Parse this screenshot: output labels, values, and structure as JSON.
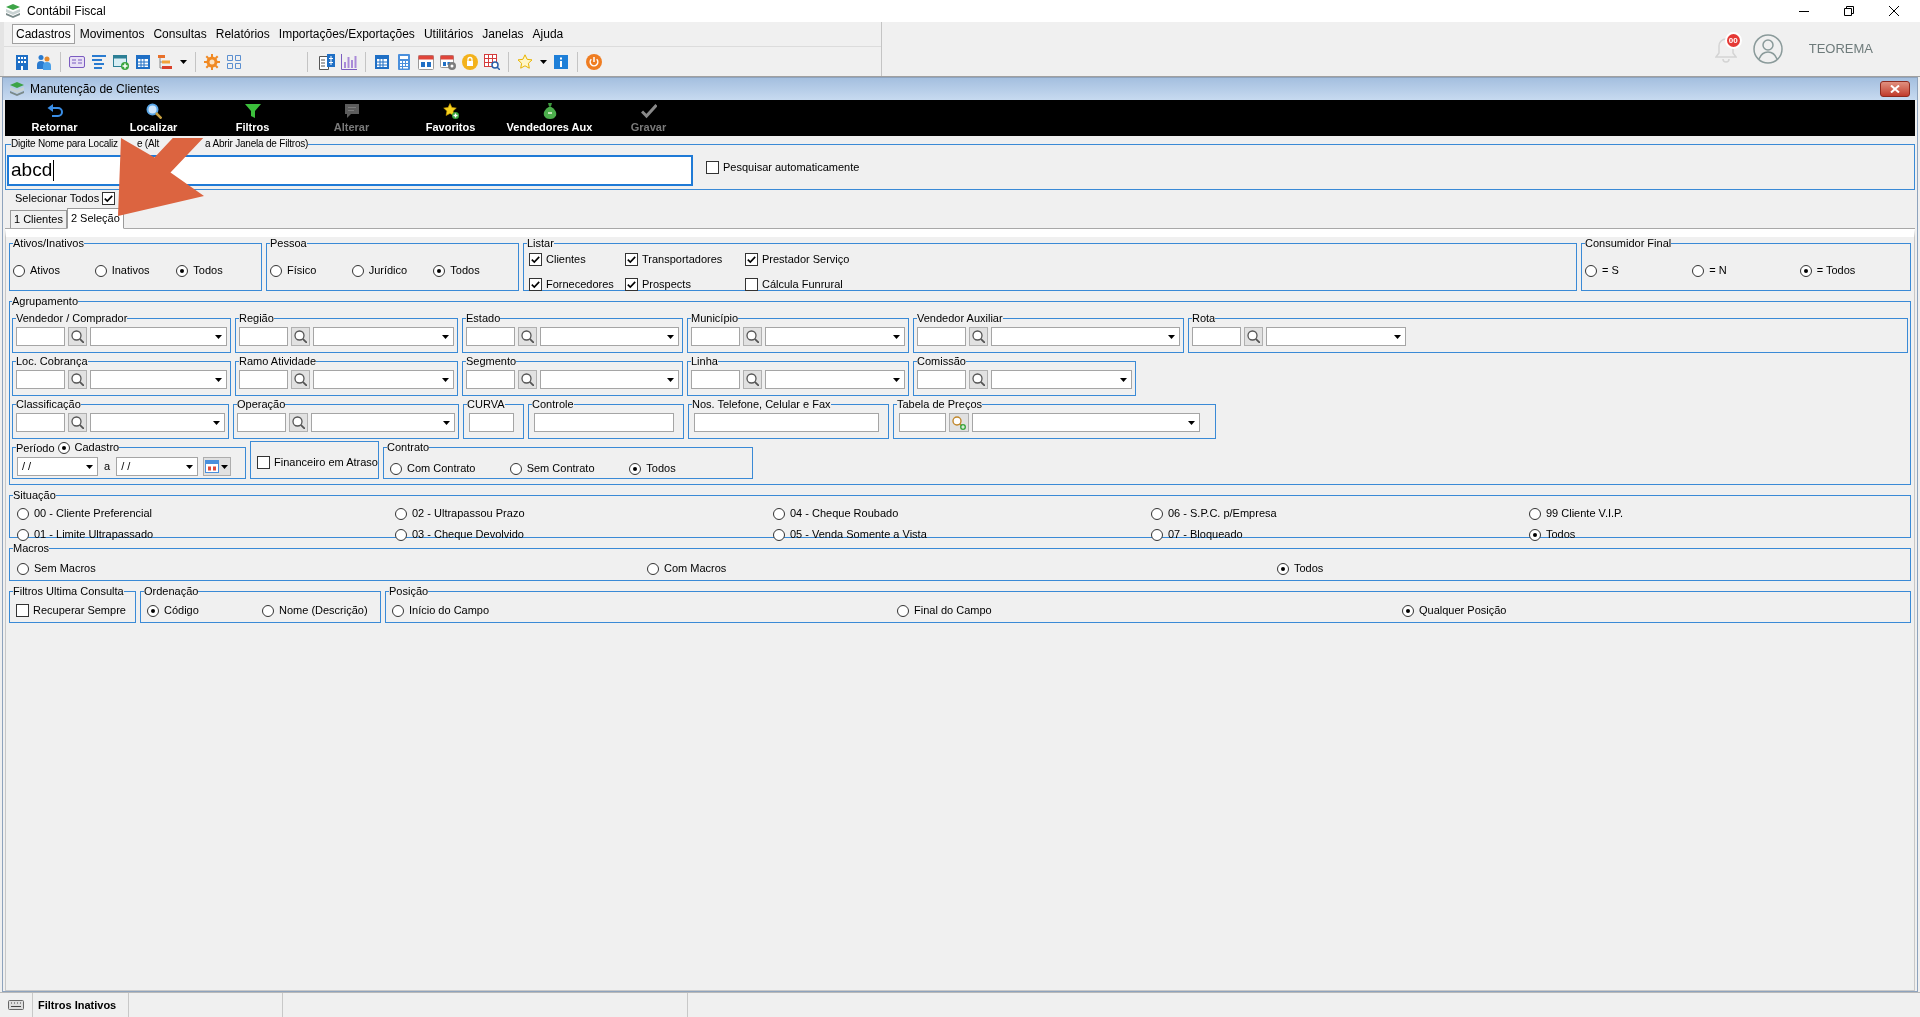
{
  "window": {
    "title": "Contábil Fiscal"
  },
  "menu": [
    {
      "label": "Cadastros",
      "selected": true
    },
    {
      "label": "Movimentos",
      "selected": false
    },
    {
      "label": "Consultas",
      "selected": false
    },
    {
      "label": "Relatórios",
      "selected": false
    },
    {
      "label": "Importações/Exportações",
      "selected": false
    },
    {
      "label": "Utilitários",
      "selected": false
    },
    {
      "label": "Janelas",
      "selected": false
    },
    {
      "label": "Ajuda",
      "selected": false
    }
  ],
  "header": {
    "notification_count": "00",
    "user": "TEOREMA"
  },
  "child_window": {
    "title": "Manutenção de Clientes"
  },
  "actions": [
    {
      "label": "Retornar",
      "disabled": false
    },
    {
      "label": "Localizar",
      "disabled": false
    },
    {
      "label": "Filtros",
      "disabled": false
    },
    {
      "label": "Alterar",
      "disabled": true
    },
    {
      "label": "Favoritos",
      "disabled": false
    },
    {
      "label": "Vendedores Aux",
      "disabled": false
    },
    {
      "label": "Gravar",
      "disabled": true
    }
  ],
  "search": {
    "label_parts": [
      "Digite Nome para Localiz",
      "e (Alt",
      "a Abrir Janela de Filtros)"
    ],
    "value": "abcd",
    "auto_search": {
      "label": "Pesquisar automaticamente",
      "checked": false
    }
  },
  "select_all": {
    "label": "Selecionar Todos",
    "checked": true
  },
  "tabs": [
    {
      "label": "1 Clientes",
      "selected": false
    },
    {
      "label": "2 Seleção",
      "selected": true
    }
  ],
  "top_groups": [
    {
      "kind": "radio",
      "title": "Ativos/Inativos",
      "options": [
        {
          "label": "Ativos",
          "selected": false
        },
        {
          "label": "Inativos",
          "selected": false
        },
        {
          "label": "Todos",
          "selected": true
        }
      ]
    },
    {
      "kind": "radio",
      "title": "Pessoa",
      "options": [
        {
          "label": "Físico",
          "selected": false
        },
        {
          "label": "Jurídico",
          "selected": false
        },
        {
          "label": "Todos",
          "selected": true
        }
      ]
    },
    {
      "kind": "checks",
      "title": "Listar",
      "options": [
        {
          "label": "Clientes",
          "checked": true
        },
        {
          "label": "Transportadores",
          "checked": true
        },
        {
          "label": "Prestador Serviço",
          "checked": true
        },
        {
          "label": "Fornecedores",
          "checked": true
        },
        {
          "label": "Prospects",
          "checked": true
        },
        {
          "label": "Cálcula Funrural",
          "checked": false
        }
      ]
    },
    {
      "kind": "radio",
      "title": "Consumidor Final",
      "options": [
        {
          "label": "= S",
          "selected": false
        },
        {
          "label": "= N",
          "selected": false
        },
        {
          "label": "= Todos",
          "selected": true
        }
      ]
    }
  ],
  "grouping": {
    "title": "Agrupamento",
    "lines": [
      {
        "groups": [
          {
            "kind": "lookup",
            "title": "Vendedor / Comprador"
          },
          {
            "kind": "lookup",
            "title": "Região"
          },
          {
            "kind": "lookup",
            "title": "Estado"
          },
          {
            "kind": "lookup",
            "title": "Município"
          },
          {
            "kind": "lookup",
            "title": "Vendedor Auxiliar"
          },
          {
            "kind": "lookup",
            "title": "Rota"
          }
        ]
      },
      {
        "groups": [
          {
            "kind": "lookup",
            "title": "Loc. Cobrança"
          },
          {
            "kind": "lookup",
            "title": "Ramo Atividade"
          },
          {
            "kind": "lookup",
            "title": "Segmento"
          },
          {
            "kind": "lookup",
            "title": "Linha"
          },
          {
            "kind": "lookup",
            "title": "Comissão"
          }
        ]
      },
      {
        "groups": [
          {
            "kind": "lookup",
            "title": "Classificação"
          },
          {
            "kind": "lookup",
            "title": "Operação"
          },
          {
            "kind": "input",
            "title": "CURVA"
          },
          {
            "kind": "input",
            "title": "Controle"
          },
          {
            "kind": "input",
            "title": "Nos. Telefone, Celular e Fax"
          },
          {
            "kind": "price_lookup",
            "title": "Tabela de Preços"
          }
        ]
      },
      {
        "groups": [
          {
            "kind": "period",
            "title": "Período",
            "option": {
              "label": "Cadastro",
              "selected": true
            },
            "from": "/ /",
            "separator": "a",
            "to": "/ /"
          },
          {
            "kind": "check",
            "label": "Financeiro em Atraso",
            "checked": false
          },
          {
            "kind": "radio",
            "title": "Contrato",
            "options": [
              {
                "label": "Com Contrato",
                "selected": false
              },
              {
                "label": "Sem Contrato",
                "selected": false
              },
              {
                "label": "Todos",
                "selected": true
              }
            ]
          }
        ]
      }
    ]
  },
  "situation": {
    "title": "Situação",
    "options": [
      {
        "label": "00 - Cliente Preferencial",
        "selected": false
      },
      {
        "label": "01 - Limite Ultrapassado",
        "selected": false
      },
      {
        "label": "02 - Ultrapassou Prazo",
        "selected": false
      },
      {
        "label": "03 - Cheque Devolvido",
        "selected": false
      },
      {
        "label": "04 - Cheque Roubado",
        "selected": false
      },
      {
        "label": "05 - Venda Somente a Vista",
        "selected": false
      },
      {
        "label": "06 - S.P.C. p/Empresa",
        "selected": false
      },
      {
        "label": "07 - Bloqueado",
        "selected": false
      },
      {
        "label": "99 Cliente V.I.P.",
        "selected": false
      },
      {
        "label": "Todos",
        "selected": true
      }
    ]
  },
  "macros": {
    "title": "Macros",
    "options": [
      {
        "label": "Sem Macros",
        "selected": false
      },
      {
        "label": "Com Macros",
        "selected": false
      },
      {
        "label": "Todos",
        "selected": true
      }
    ]
  },
  "bottom_groups": [
    {
      "kind": "check",
      "title": "Filtros Ultima Consulta",
      "label": "Recuperar Sempre",
      "checked": false
    },
    {
      "kind": "radio",
      "title": "Ordenação",
      "options": [
        {
          "label": "Código",
          "selected": true
        },
        {
          "label": "Nome (Descrição)",
          "selected": false
        }
      ]
    },
    {
      "kind": "radio",
      "title": "Posição",
      "options": [
        {
          "label": "Início do Campo",
          "selected": false
        },
        {
          "label": "Final do Campo",
          "selected": false
        },
        {
          "label": "Qualquer Posição",
          "selected": true
        }
      ]
    }
  ],
  "status_bar": {
    "panels": [
      "Filtros Inativos"
    ]
  }
}
